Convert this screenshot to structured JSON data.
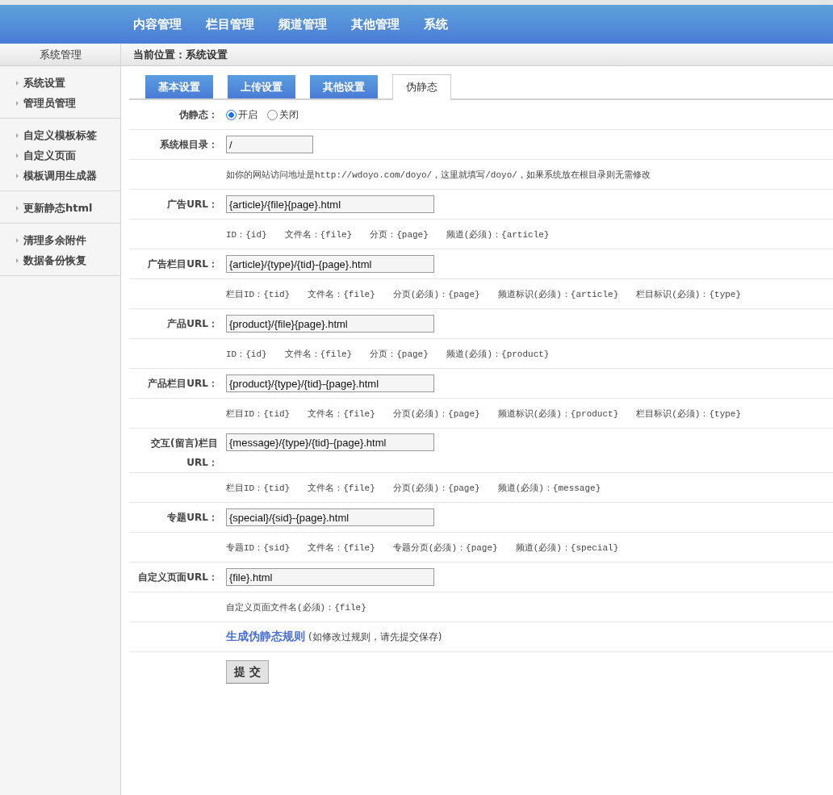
{
  "top_nav": [
    {
      "label": "内容管理"
    },
    {
      "label": "栏目管理"
    },
    {
      "label": "频道管理"
    },
    {
      "label": "其他管理"
    },
    {
      "label": "系统"
    }
  ],
  "sidebar": {
    "title": "系统管理",
    "groups": [
      {
        "items": [
          "系统设置",
          "管理员管理"
        ]
      },
      {
        "items": [
          "自定义模板标签",
          "自定义页面",
          "模板调用生成器"
        ]
      },
      {
        "items": [
          "更新静态html"
        ]
      },
      {
        "items": [
          "清理多余附件",
          "数据备份恢复"
        ]
      }
    ]
  },
  "breadcrumb": "当前位置：系统设置",
  "tabs": [
    {
      "label": "基本设置",
      "selected": false
    },
    {
      "label": "上传设置",
      "selected": false
    },
    {
      "label": "其他设置",
      "selected": false
    },
    {
      "label": "伪静态",
      "selected": true
    }
  ],
  "form_rows": [
    {
      "kind": "radio",
      "label": "伪静态：",
      "options": [
        {
          "label": "开启",
          "selected": true
        },
        {
          "label": "关闭",
          "selected": false
        }
      ]
    },
    {
      "kind": "shortinput",
      "label": "系统根目录：",
      "value": "/"
    },
    {
      "kind": "hint",
      "items": [
        "如你的网站访问地址是http://wdoyo.com/doyo/，这里就填写/doyo/，如果系统放在根目录则无需修改"
      ]
    },
    {
      "kind": "input",
      "label": "广告URL：",
      "value": "{article}/{file}{page}.html"
    },
    {
      "kind": "hint",
      "items": [
        "ID：{id}",
        "文件名：{file}",
        "分页：{page}",
        "频道(必须)：{article}"
      ]
    },
    {
      "kind": "input",
      "label": "广告栏目URL：",
      "value": "{article}/{type}/{tid}-{page}.html"
    },
    {
      "kind": "hint",
      "items": [
        "栏目ID：{tid}",
        "文件名：{file}",
        "分页(必须)：{page}",
        "频道标识(必须)：{article}",
        "栏目标识(必须)：{type}"
      ]
    },
    {
      "kind": "input",
      "label": "产品URL：",
      "value": "{product}/{file}{page}.html"
    },
    {
      "kind": "hint",
      "items": [
        "ID：{id}",
        "文件名：{file}",
        "分页：{page}",
        "频道(必须)：{product}"
      ]
    },
    {
      "kind": "input",
      "label": "产品栏目URL：",
      "value": "{product}/{type}/{tid}-{page}.html"
    },
    {
      "kind": "hint",
      "items": [
        "栏目ID：{tid}",
        "文件名：{file}",
        "分页(必须)：{page}",
        "频道标识(必须)：{product}",
        "栏目标识(必须)：{type}"
      ]
    },
    {
      "kind": "input",
      "label": "交互(留言)栏目URL：",
      "value": "{message}/{type}/{tid}-{page}.html"
    },
    {
      "kind": "hint",
      "items": [
        "栏目ID：{tid}",
        "文件名：{file}",
        "分页(必须)：{page}",
        "频道(必须)：{message}"
      ]
    },
    {
      "kind": "input",
      "label": "专题URL：",
      "value": "{special}/{sid}-{page}.html"
    },
    {
      "kind": "hint",
      "items": [
        "专题ID：{sid}",
        "文件名：{file}",
        "专题分页(必须)：{page}",
        "频道(必须)：{special}"
      ]
    },
    {
      "kind": "input",
      "label": "自定义页面URL：",
      "value": "{file}.html"
    },
    {
      "kind": "hint",
      "items": [
        "自定义页面文件名(必须)：{file}"
      ]
    },
    {
      "kind": "link",
      "link": "生成伪静态规则",
      "note": "(如修改过规则，请先提交保存)"
    },
    {
      "kind": "submit",
      "button": "提 交"
    }
  ]
}
